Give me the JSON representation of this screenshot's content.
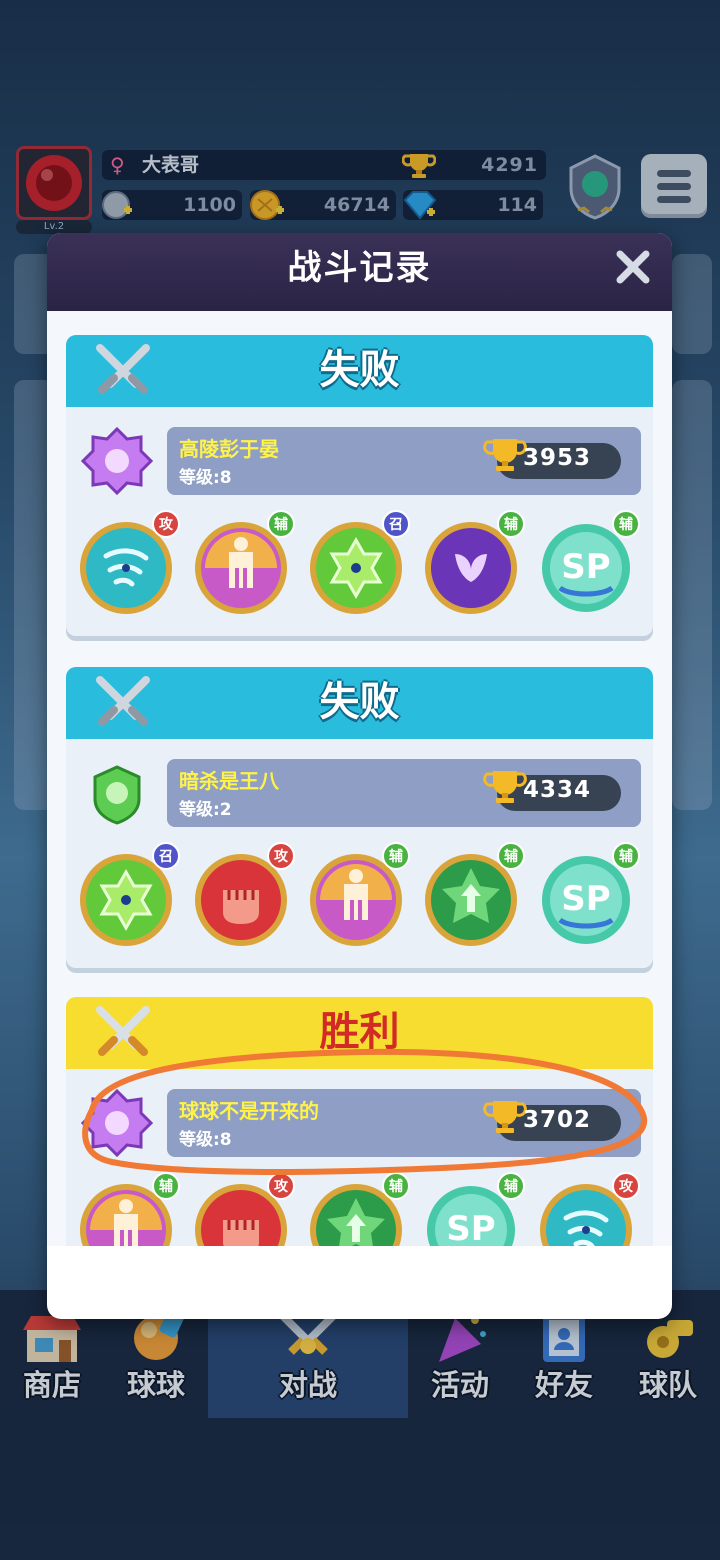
{
  "hud": {
    "player_name": "大表哥",
    "level": "Lv.2",
    "trophies": "4291",
    "currency_silver": "1100",
    "currency_gold": "46714",
    "currency_gem": "114"
  },
  "modal": {
    "title": "战斗记录"
  },
  "records": [
    {
      "result": "失败",
      "player_name": "高陵彭于晏",
      "level": "等级:8",
      "trophies": "3953",
      "balls": [
        {
          "icon": "whirlwind-ball",
          "tag": "攻"
        },
        {
          "icon": "clone-ball",
          "tag": "辅"
        },
        {
          "icon": "summon-star-ball",
          "tag": "召"
        },
        {
          "icon": "purple-butterfly-ball",
          "tag": "辅"
        },
        {
          "icon": "sp-hands-ball",
          "tag": "辅"
        }
      ]
    },
    {
      "result": "失败",
      "player_name": "暗杀是王八",
      "level": "等级:2",
      "trophies": "4334",
      "balls": [
        {
          "icon": "summon-star-ball",
          "tag": "召"
        },
        {
          "icon": "fist-ball",
          "tag": "攻"
        },
        {
          "icon": "clone-ball",
          "tag": "辅"
        },
        {
          "icon": "green-arrow-star-ball",
          "tag": "辅"
        },
        {
          "icon": "sp-hands-ball",
          "tag": "辅"
        }
      ]
    },
    {
      "result": "胜利",
      "player_name": "球球不是开来的",
      "level": "等级:8",
      "trophies": "3702",
      "balls": [
        {
          "icon": "clone-ball",
          "tag": "辅"
        },
        {
          "icon": "fist-ball",
          "tag": "攻"
        },
        {
          "icon": "green-arrow-star-ball",
          "tag": "辅"
        },
        {
          "icon": "sp-hands-ball",
          "tag": "辅"
        },
        {
          "icon": "whirlwind-ball",
          "tag": "攻"
        }
      ]
    }
  ],
  "nav": {
    "shop": "商店",
    "balls": "球球",
    "battle": "对战",
    "events": "活动",
    "friends": "好友",
    "team": "球队"
  },
  "colors": {
    "lose_header": "#29bcdd",
    "win_header": "#f7dd2f",
    "win_text": "#d22b25",
    "annotation": "#f07a35"
  }
}
